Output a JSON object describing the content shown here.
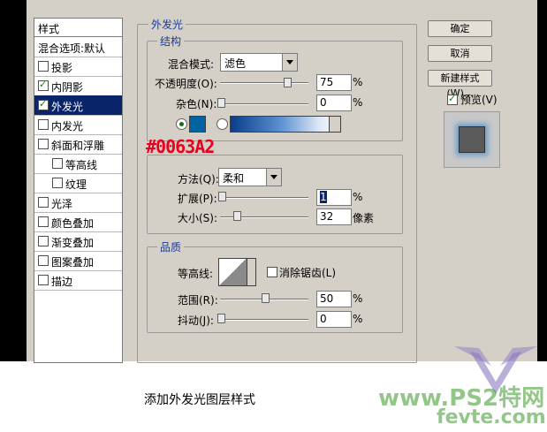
{
  "styles_list": {
    "header": "样式",
    "blend_options": "混合选项:默认",
    "items": [
      {
        "label": "投影",
        "checked": false
      },
      {
        "label": "内阴影",
        "checked": true
      },
      {
        "label": "外发光",
        "checked": true,
        "selected": true
      },
      {
        "label": "内发光",
        "checked": false
      },
      {
        "label": "斜面和浮雕",
        "checked": false
      },
      {
        "label": "等高线",
        "checked": false,
        "indent": true
      },
      {
        "label": "纹理",
        "checked": false,
        "indent": true
      },
      {
        "label": "光泽",
        "checked": false
      },
      {
        "label": "颜色叠加",
        "checked": false
      },
      {
        "label": "渐变叠加",
        "checked": false
      },
      {
        "label": "图案叠加",
        "checked": false
      },
      {
        "label": "描边",
        "checked": false
      }
    ]
  },
  "panel": {
    "title": "外发光",
    "structure": {
      "title": "结构",
      "blend_mode_label": "混合模式:",
      "blend_mode_value": "滤色",
      "opacity_label": "不透明度(O):",
      "opacity_value": "75",
      "noise_label": "杂色(N):",
      "noise_value": "0",
      "unit": "%",
      "color_hex": "#0063A2"
    },
    "elements": {
      "method_label": "方法(Q):",
      "method_value": "柔和",
      "spread_label": "扩展(P):",
      "spread_value": "1",
      "size_label": "大小(S):",
      "size_value": "32",
      "size_unit": "像素",
      "unit": "%"
    },
    "quality": {
      "title": "品质",
      "contour_label": "等高线:",
      "antialias_label": "消除锯齿(L)",
      "antialias_checked": false,
      "range_label": "范围(R):",
      "range_value": "50",
      "jitter_label": "抖动(J):",
      "jitter_value": "0",
      "unit": "%"
    }
  },
  "buttons": {
    "ok": "确定",
    "cancel": "取消",
    "new_style": "新建样式(W)...",
    "preview_label": "预览(V)",
    "preview_checked": true
  },
  "annotation": "#0063A2",
  "caption": "添加外发光图层样式",
  "watermark": {
    "line1": "www.PS2特网",
    "line2": "fevte.com"
  }
}
